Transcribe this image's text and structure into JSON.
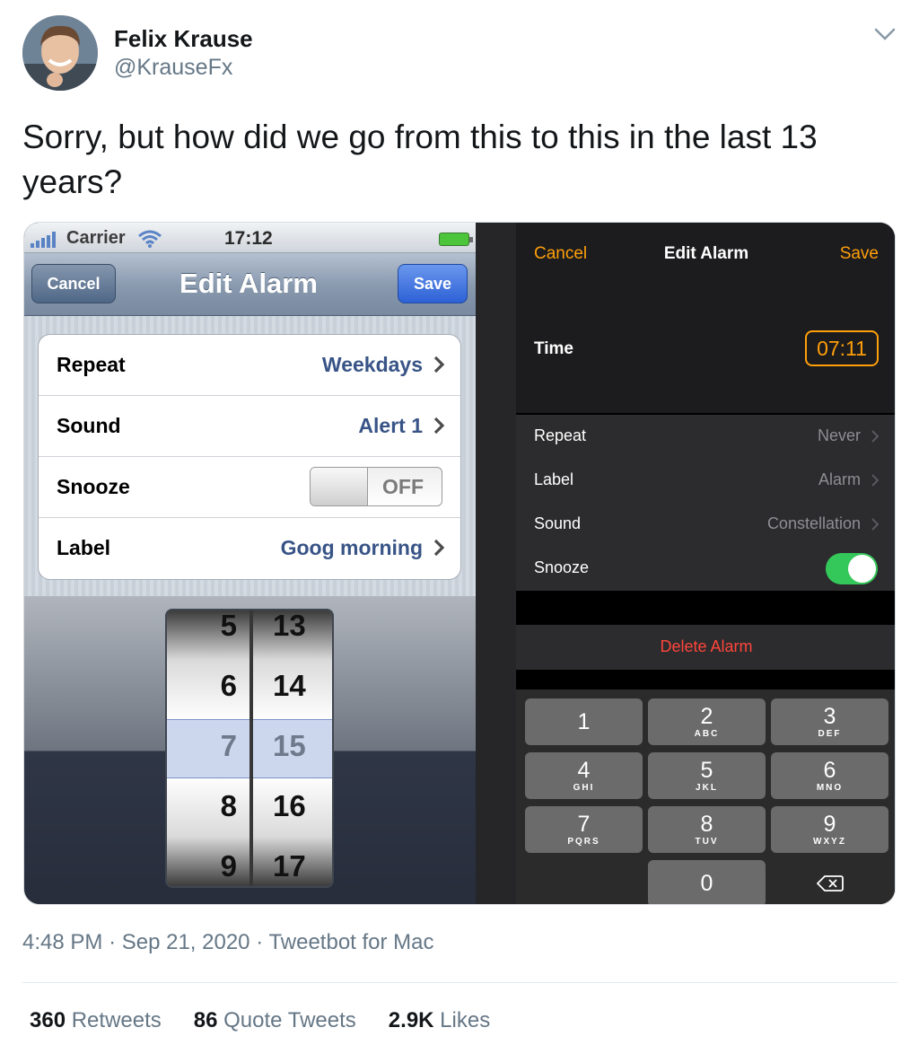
{
  "author": {
    "name": "Felix Krause",
    "handle": "@KrauseFx",
    "icons": {
      "avatar": "profile-photo",
      "menu": "chevron-down-icon"
    }
  },
  "tweet": {
    "text": "Sorry, but how did we go from this to this in the last 13 years?"
  },
  "old_ios": {
    "status_bar": {
      "carrier": "Carrier",
      "time": "17:12",
      "icons": [
        "signal-bars-icon",
        "wifi-icon",
        "battery-icon"
      ]
    },
    "nav": {
      "cancel": "Cancel",
      "title": "Edit Alarm",
      "save": "Save"
    },
    "rows": [
      {
        "label": "Repeat",
        "value": "Weekdays"
      },
      {
        "label": "Sound",
        "value": "Alert 1"
      },
      {
        "label": "Snooze",
        "toggle": "OFF"
      },
      {
        "label": "Label",
        "value": "Goog morning"
      }
    ],
    "picker": {
      "hours": [
        "5",
        "6",
        "7",
        "8",
        "9"
      ],
      "minutes": [
        "13",
        "14",
        "15",
        "16",
        "17"
      ],
      "selected_hour": "7",
      "selected_minute": "15"
    }
  },
  "new_ios": {
    "nav": {
      "cancel": "Cancel",
      "title": "Edit Alarm",
      "save": "Save"
    },
    "time": {
      "label": "Time",
      "value": "07:11"
    },
    "rows": [
      {
        "label": "Repeat",
        "value": "Never"
      },
      {
        "label": "Label",
        "value": "Alarm"
      },
      {
        "label": "Sound",
        "value": "Constellation"
      },
      {
        "label": "Snooze",
        "toggle": "on"
      }
    ],
    "delete": "Delete Alarm",
    "keypad": [
      {
        "num": "1",
        "letters": ""
      },
      {
        "num": "2",
        "letters": "ABC"
      },
      {
        "num": "3",
        "letters": "DEF"
      },
      {
        "num": "4",
        "letters": "GHI"
      },
      {
        "num": "5",
        "letters": "JKL"
      },
      {
        "num": "6",
        "letters": "MNO"
      },
      {
        "num": "7",
        "letters": "PQRS"
      },
      {
        "num": "8",
        "letters": "TUV"
      },
      {
        "num": "9",
        "letters": "WXYZ"
      },
      {
        "num": "0",
        "letters": ""
      }
    ],
    "accent": "#ff9f0a",
    "toggle_color": "#34c759",
    "delete_color": "#ff453a"
  },
  "meta": {
    "time": "4:48 PM",
    "sep1": "·",
    "date": "Sep 21, 2020",
    "sep2": "·",
    "client": "Tweetbot for Mac"
  },
  "stats": {
    "retweets": {
      "count": "360",
      "label": "Retweets"
    },
    "quotes": {
      "count": "86",
      "label": "Quote Tweets"
    },
    "likes": {
      "count": "2.9K",
      "label": "Likes"
    }
  }
}
